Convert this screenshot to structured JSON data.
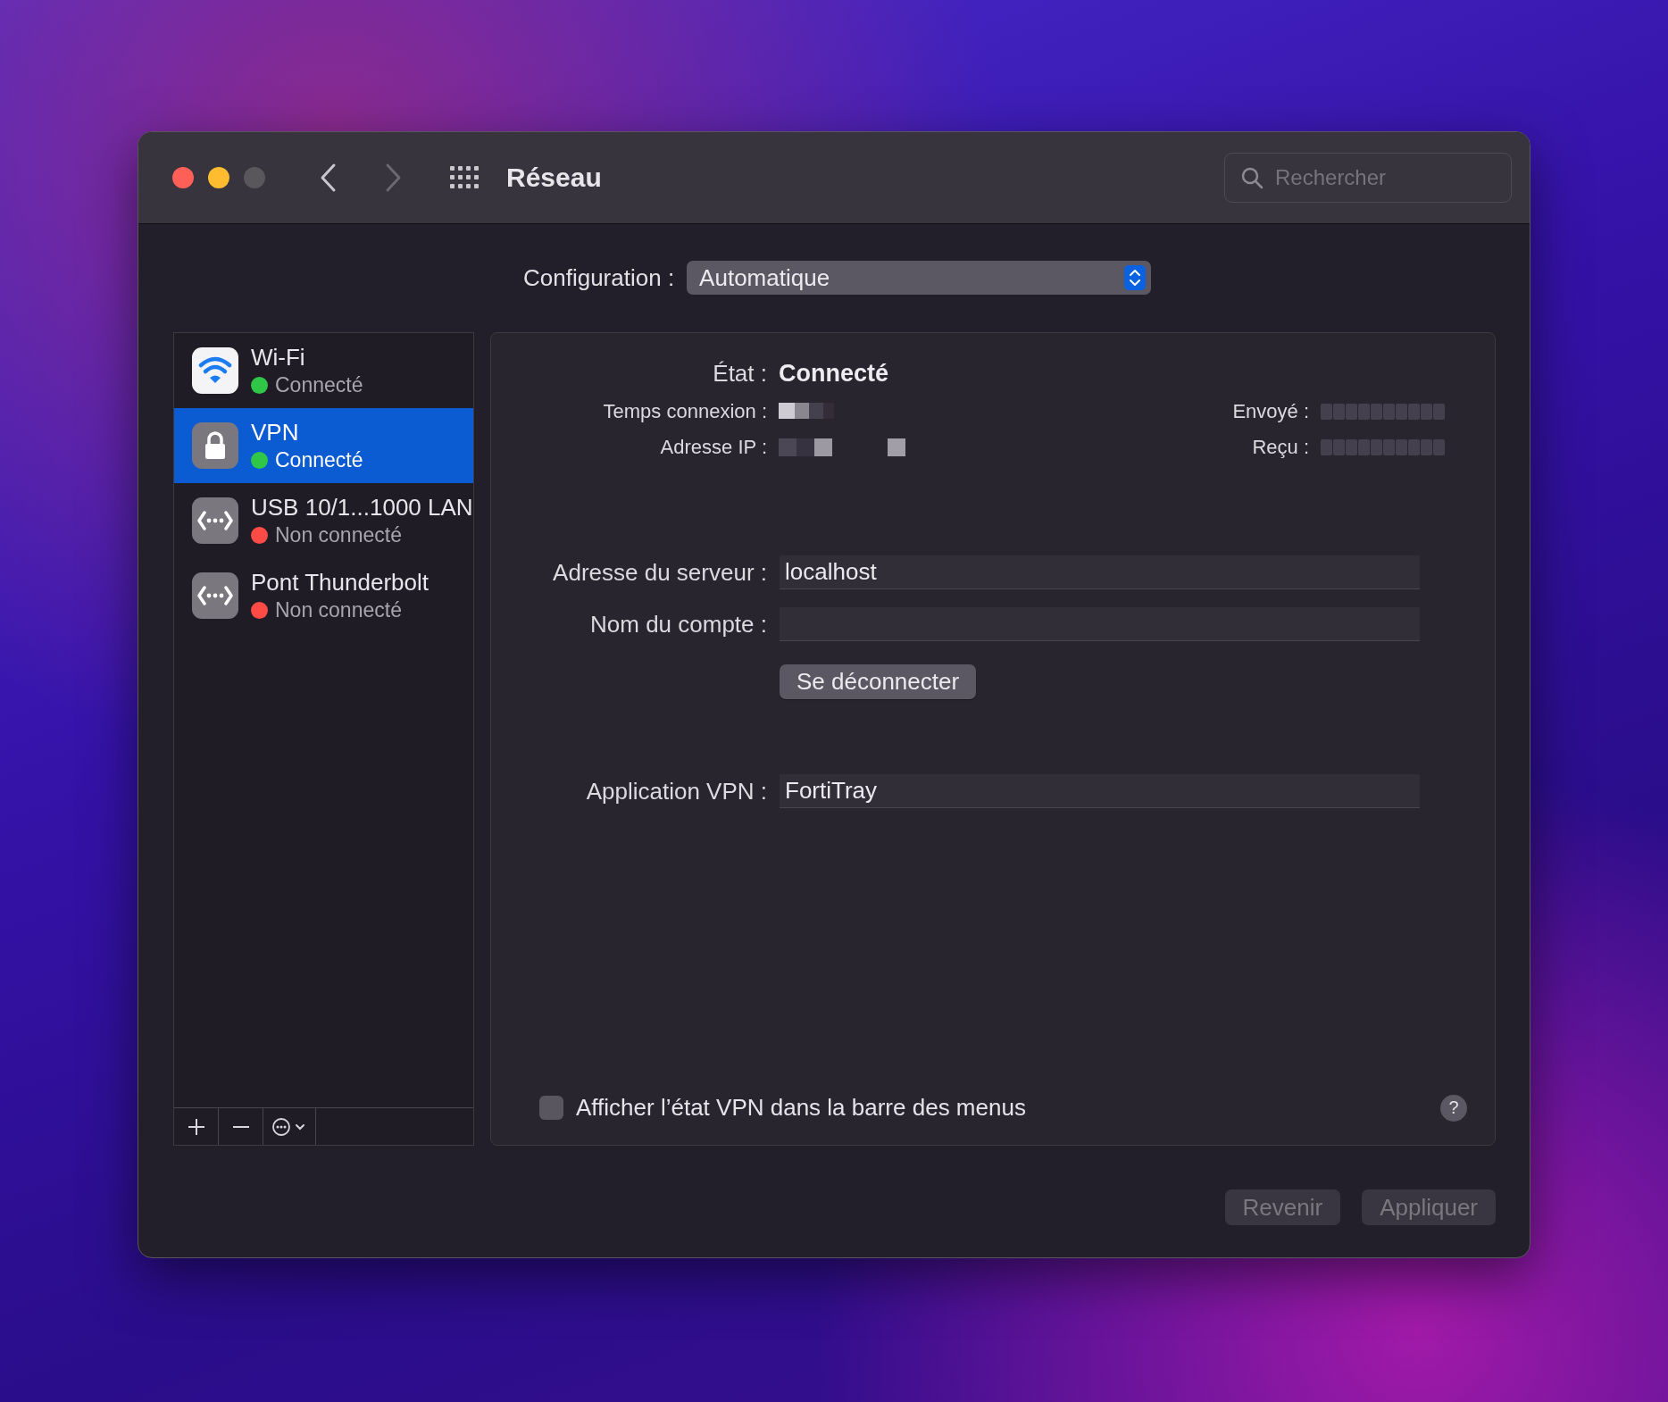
{
  "window": {
    "title": "Réseau"
  },
  "search": {
    "placeholder": "Rechercher"
  },
  "configuration": {
    "label": "Configuration :",
    "value": "Automatique"
  },
  "services": [
    {
      "name": "Wi-Fi",
      "status": "Connecté",
      "kind": "wifi",
      "color": "#30c748",
      "selected": false
    },
    {
      "name": "VPN",
      "status": "Connecté",
      "kind": "vpn",
      "color": "#30c748",
      "selected": true
    },
    {
      "name": "USB 10/1...1000 LAN",
      "status": "Non connecté",
      "kind": "ethernet",
      "color": "#fe4b45",
      "selected": false
    },
    {
      "name": "Pont Thunderbolt",
      "status": "Non connecté",
      "kind": "ethernet",
      "color": "#fe4b45",
      "selected": false
    }
  ],
  "status": {
    "label": "État :",
    "value": "Connecté"
  },
  "details": [
    {
      "label": "Temps connexion :"
    },
    {
      "label": "Adresse IP :"
    }
  ],
  "counters": [
    {
      "label": "Envoyé :"
    },
    {
      "label": "Reçu :"
    }
  ],
  "fields": [
    {
      "label": "Adresse du serveur :",
      "value": "localhost"
    },
    {
      "label": "Nom du compte :"
    }
  ],
  "disconnect_button": "Se déconnecter",
  "app_field": {
    "label": "Application VPN :",
    "value": "FortiTray"
  },
  "menu_bar_checkbox": {
    "label": "Afficher l’état VPN dans la barre des menus",
    "checked": false
  },
  "help_button": "?",
  "buttons": [
    {
      "label": "Revenir",
      "disabled": true
    },
    {
      "label": "Appliquer",
      "disabled": true
    }
  ]
}
